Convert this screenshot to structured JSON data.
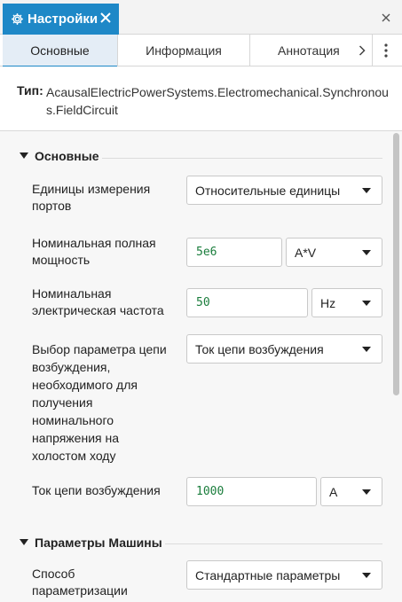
{
  "window_tab": {
    "title": "Настройки",
    "icon": "gear-icon",
    "close_icon": "close-icon"
  },
  "panel_close_icon": "close-icon",
  "tabs": [
    {
      "label": "Основные",
      "active": true
    },
    {
      "label": "Информация",
      "active": false
    },
    {
      "label": "Аннотация",
      "active": false
    }
  ],
  "type": {
    "label": "Тип:",
    "value": "AcausalElectricPowerSystems.Electromechanical.Synchronous.FieldCircuit"
  },
  "sections": {
    "main": {
      "title": "Основные"
    },
    "machine": {
      "title": "Параметры Машины"
    }
  },
  "fields": {
    "port_units": {
      "label": "Единицы измерения портов",
      "value": "Относительные единицы"
    },
    "rated_power": {
      "label": "Номинальная полная мощность",
      "value": "5e6",
      "unit": "A*V"
    },
    "rated_frequency": {
      "label": "Номинальная электрическая частота",
      "value": "50",
      "unit": "Hz"
    },
    "field_param": {
      "label": "Выбор параметра цепи возбуждения, необходимого для получения номинального напряжения на холостом ходу",
      "value": "Ток цепи возбуждения"
    },
    "field_current": {
      "label": "Ток цепи возбуждения",
      "value": "1000",
      "unit": "A"
    },
    "parametrization": {
      "label": "Способ параметризации",
      "value": "Стандартные параметры"
    }
  },
  "colors": {
    "accent": "#1e88c7",
    "value_text": "#1a7d3c"
  }
}
